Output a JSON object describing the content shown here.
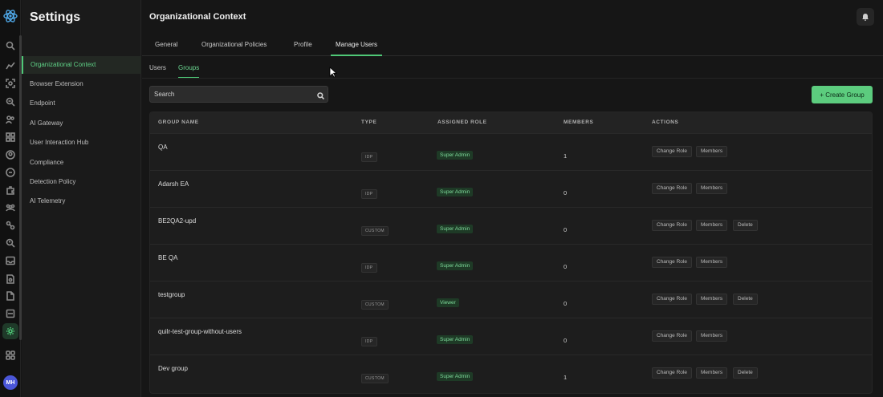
{
  "rail": {
    "icons": [
      "search-icon",
      "analytics-icon",
      "scan-icon",
      "inspect-icon",
      "users-icon",
      "apps-icon",
      "user-circle-icon",
      "shield-icon",
      "plugin-icon",
      "team-icon",
      "link-icon",
      "alerts-icon",
      "inbox-icon",
      "file-search-icon",
      "document-icon",
      "server-icon",
      "settings-icon",
      "grid-icon"
    ],
    "active": "settings-icon",
    "avatar_initials": "MH"
  },
  "sidebar": {
    "title": "Settings",
    "items": [
      {
        "label": "Organizational Context",
        "active": true
      },
      {
        "label": "Browser Extension",
        "active": false
      },
      {
        "label": "Endpoint",
        "active": false
      },
      {
        "label": "AI Gateway",
        "active": false
      },
      {
        "label": "User Interaction Hub",
        "active": false
      },
      {
        "label": "Compliance",
        "active": false
      },
      {
        "label": "Detection Policy",
        "active": false
      },
      {
        "label": "AI Telemetry",
        "active": false
      }
    ]
  },
  "main": {
    "title": "Organizational Context",
    "tabs": [
      {
        "label": "General",
        "active": false
      },
      {
        "label": "Organizational Policies",
        "active": false
      },
      {
        "label": "Profile",
        "active": false
      },
      {
        "label": "Manage Users",
        "active": true
      }
    ],
    "subtabs": [
      {
        "label": "Users",
        "active": false
      },
      {
        "label": "Groups",
        "active": true
      }
    ],
    "search": {
      "placeholder": "Search"
    },
    "create_button": "+ Create Group",
    "table": {
      "columns": [
        "GROUP NAME",
        "TYPE",
        "ASSIGNED ROLE",
        "MEMBERS",
        "ACTIONS"
      ],
      "rows": [
        {
          "name": "QA",
          "type": "IDP",
          "role": "Super Admin",
          "members": "1",
          "actions": [
            "Change Role",
            "Members"
          ]
        },
        {
          "name": "Adarsh EA",
          "type": "IDP",
          "role": "Super Admin",
          "members": "0",
          "actions": [
            "Change Role",
            "Members"
          ]
        },
        {
          "name": "BE2QA2-upd",
          "type": "CUSTOM",
          "role": "Super Admin",
          "members": "0",
          "actions": [
            "Change Role",
            "Members",
            "Delete"
          ]
        },
        {
          "name": "BE QA",
          "type": "IDP",
          "role": "Super Admin",
          "members": "0",
          "actions": [
            "Change Role",
            "Members"
          ]
        },
        {
          "name": "testgroup",
          "type": "CUSTOM",
          "role": "Viewer",
          "members": "0",
          "actions": [
            "Change Role",
            "Members",
            "Delete"
          ]
        },
        {
          "name": "quilr-test-group-without-users",
          "type": "IDP",
          "role": "Super Admin",
          "members": "0",
          "actions": [
            "Change Role",
            "Members"
          ]
        },
        {
          "name": "Dev group",
          "type": "CUSTOM",
          "role": "Super Admin",
          "members": "1",
          "actions": [
            "Change Role",
            "Members",
            "Delete"
          ]
        }
      ]
    }
  },
  "colors": {
    "accent": "#4fc877",
    "background": "#161616",
    "role_badge_bg": "#1e3a26"
  }
}
